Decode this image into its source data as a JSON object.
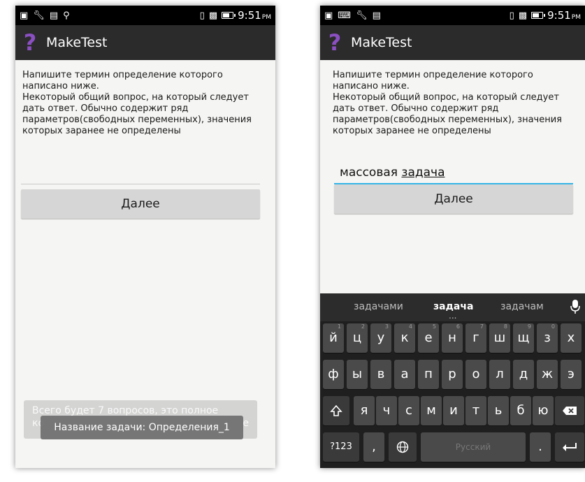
{
  "status_bar": {
    "time": "9:51",
    "ampm": "PM"
  },
  "app": {
    "title": "MakeTest",
    "icon_glyph": "?",
    "icon_color": "#8a4fc0"
  },
  "question": {
    "text": "Напишите термин определение которого\nнаписано ниже.\nНекоторый общий вопрос, на который следует\nдать ответ. Обычно содержит ряд\nпараметров(свободных переменных), значения\nкоторых заранее не определены"
  },
  "left_screen": {
    "answer_value": "",
    "next_label": "Далее",
    "toast_behind": "Всего будет 7 вопросов, это полное",
    "toast_behind_2": "ко",
    "toast_behind_2_tail": "е",
    "toast_text": "Название задачи: Определения_1"
  },
  "right_screen": {
    "answer_word1": "массовая",
    "answer_word2": "задача",
    "next_label": "Далее"
  },
  "keyboard": {
    "suggestions": [
      "задачами",
      "задача",
      "задачам"
    ],
    "suggestion_dots": "...",
    "row1": [
      {
        "k": "й",
        "n": "1"
      },
      {
        "k": "ц",
        "n": "2"
      },
      {
        "k": "у",
        "n": "3"
      },
      {
        "k": "к",
        "n": "4"
      },
      {
        "k": "е",
        "n": "5"
      },
      {
        "k": "н",
        "n": "6"
      },
      {
        "k": "г",
        "n": "7"
      },
      {
        "k": "ш",
        "n": "8"
      },
      {
        "k": "щ",
        "n": "9"
      },
      {
        "k": "з",
        "n": "0"
      },
      {
        "k": "х",
        "n": ""
      }
    ],
    "row2": [
      "ф",
      "ы",
      "в",
      "а",
      "п",
      "р",
      "о",
      "л",
      "д",
      "ж",
      "э"
    ],
    "row3": [
      "я",
      "ч",
      "с",
      "м",
      "и",
      "т",
      "ь",
      "б",
      "ю"
    ],
    "symbols_label": "?123",
    "comma_label": ",",
    "space_label": "Русский",
    "period_label": "."
  },
  "colors": {
    "accent": "#33b5e5",
    "action_bar": "#2b2b2b",
    "keyboard_bg": "#1f1f1f",
    "key": "#4a4a4a"
  }
}
